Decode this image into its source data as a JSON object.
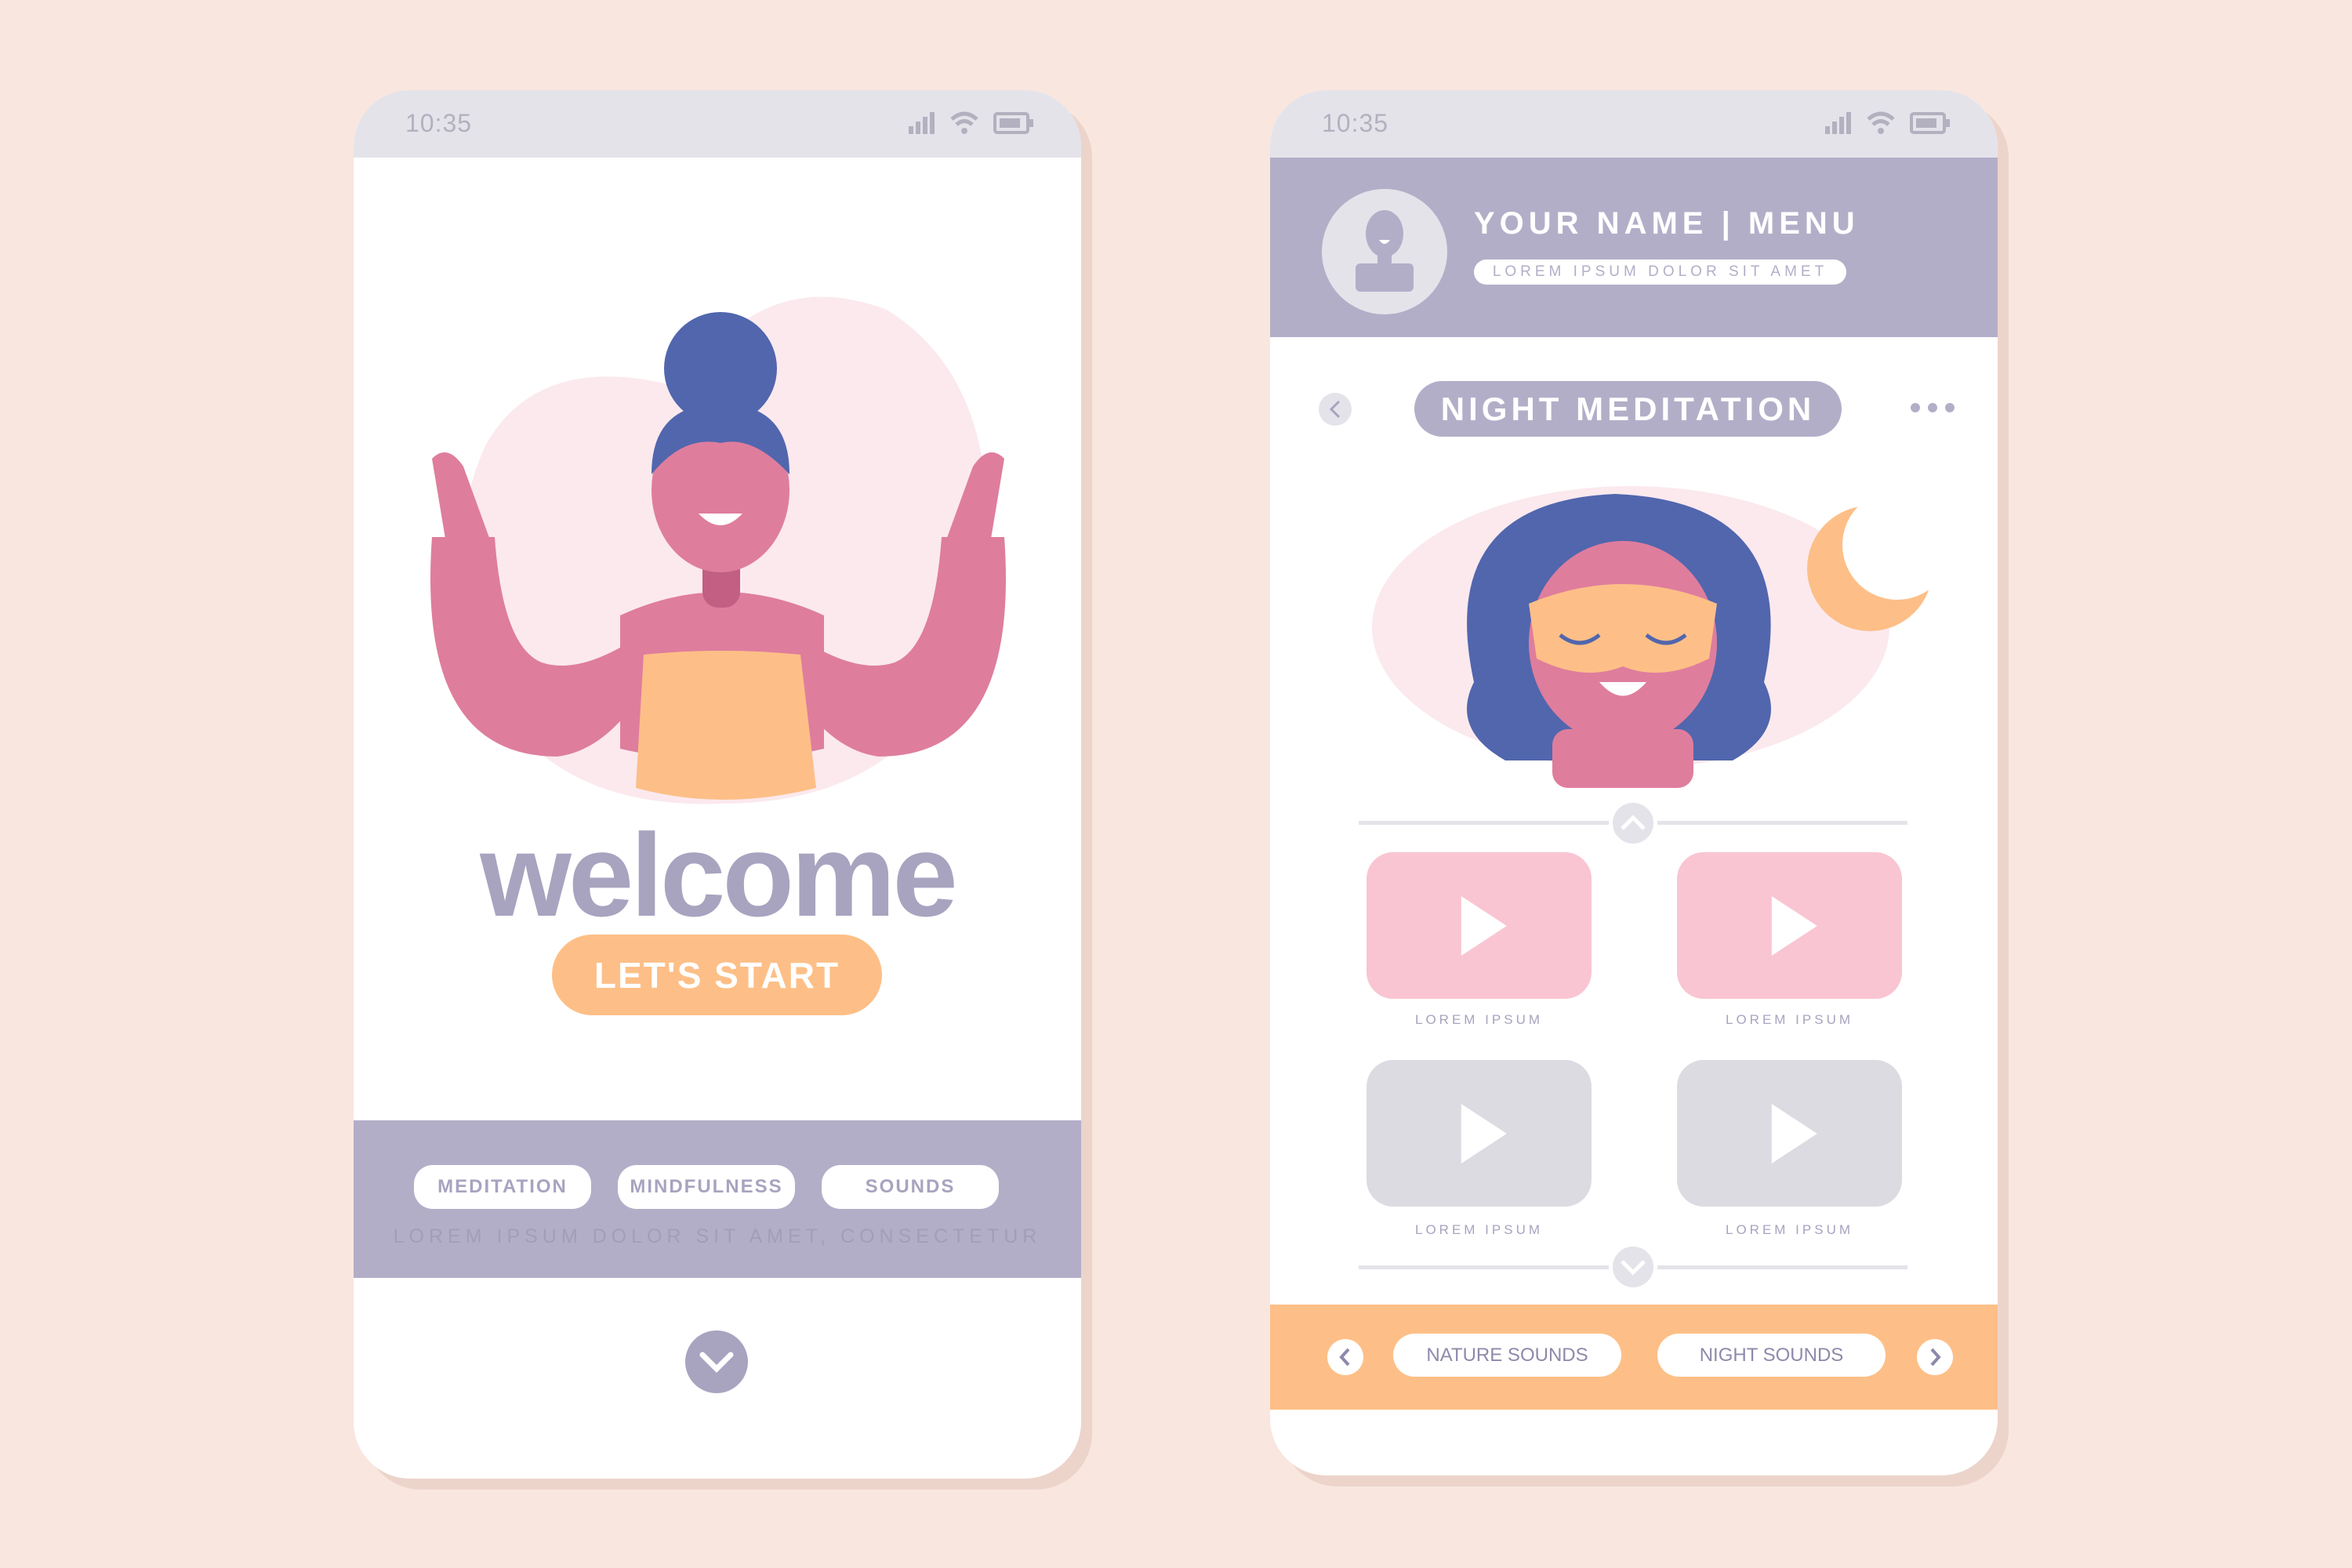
{
  "colors": {
    "background": "#f9e6df",
    "lavender": "#b3aec8",
    "orange": "#fdbf87",
    "pink": "#f9c5d2",
    "grey": "#dcdbe2",
    "text": "#a8a3bf"
  },
  "left_phone": {
    "status": {
      "time": "10:35",
      "icons": [
        "signal-icon",
        "wifi-icon",
        "battery-icon"
      ]
    },
    "welcome": "welcome",
    "start_button": "LET'S START",
    "tabs": [
      "MEDITATION",
      "MINDFULNESS",
      "SOUNDS"
    ],
    "caption": "LOREM IPSUM DOLOR SIT AMET, CONSECTETUR",
    "scroll_icon": "chevron-down-icon"
  },
  "right_phone": {
    "status": {
      "time": "10:35",
      "icons": [
        "signal-icon",
        "wifi-icon",
        "battery-icon"
      ]
    },
    "header": {
      "title": "YOUR NAME | MENU",
      "subtitle": "LOREM IPSUM DOLOR SIT AMET",
      "avatar": "user-icon"
    },
    "section_title": "NIGHT MEDITATION",
    "videos": [
      {
        "label": "LOREM IPSUM",
        "style": "pink"
      },
      {
        "label": "LOREM IPSUM",
        "style": "pink"
      },
      {
        "label": "LOREM IPSUM",
        "style": "grey"
      },
      {
        "label": "LOREM IPSUM",
        "style": "grey"
      }
    ],
    "bottom_tabs": [
      "NATURE SOUNDS",
      "NIGHT SOUNDS"
    ]
  }
}
